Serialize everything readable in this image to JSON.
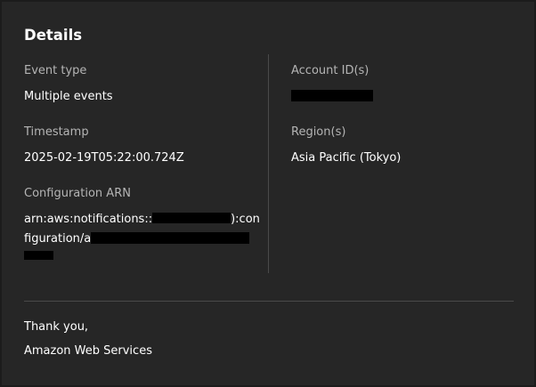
{
  "details": {
    "heading": "Details",
    "event_type": {
      "label": "Event type",
      "value": "Multiple events"
    },
    "timestamp": {
      "label": "Timestamp",
      "value": "2025-02-19T05:22:00.724Z"
    },
    "configuration_arn": {
      "label": "Configuration ARN",
      "line1_prefix": "arn:aws:notifications::",
      "line1_suffix": "):con",
      "line2_prefix": "figuration/a"
    },
    "account_ids": {
      "label": "Account ID(s)"
    },
    "region": {
      "label": "Region(s)",
      "value": "Asia Pacific (Tokyo)"
    }
  },
  "footer": {
    "thanks": "Thank you,",
    "signature": "Amazon Web Services"
  },
  "colors": {
    "background": "#262626",
    "label": "#b4b4b4",
    "text": "#ffffff",
    "divider": "#4a4a4a",
    "redaction": "#000000"
  }
}
